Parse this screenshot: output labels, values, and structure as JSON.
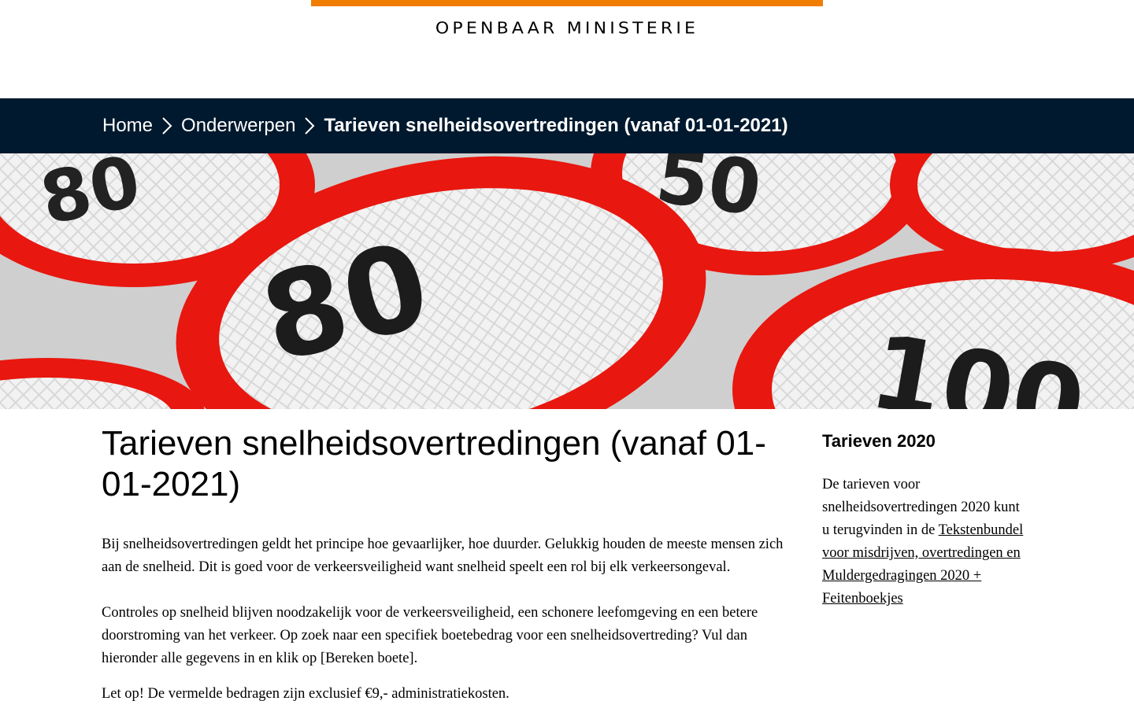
{
  "header": {
    "logo_text": "OPENBAAR MINISTERIE",
    "accent_color": "#f07d00"
  },
  "breadcrumb": {
    "background": "#01192e",
    "items": [
      {
        "label": "Home"
      },
      {
        "label": "Onderwerpen"
      }
    ],
    "current": "Tarieven snelheidsovertredingen (vanaf 01-01-2021)"
  },
  "hero": {
    "alt": "speed-limit-signs-photo",
    "signs": [
      "80",
      "50",
      "100"
    ]
  },
  "main": {
    "title": "Tarieven snelheidsovertredingen (vanaf 01-01-2021)",
    "paragraphs": [
      "Bij snelheidsovertredingen geldt het principe hoe gevaarlijker, hoe duurder. Gelukkig houden de meeste mensen zich aan de snelheid. Dit is goed voor de verkeersveiligheid want snelheid speelt een rol bij elk verkeersongeval.",
      "Controles op snelheid blijven noodzakelijk voor de verkeersveiligheid, een schonere leefomgeving en een betere doorstroming van het verkeer. Op zoek naar een specifiek boetebedrag voor een snelheidsovertreding? Vul dan hieronder alle gegevens in en klik op [Bereken boete].",
      "Let op! De vermelde bedragen zijn exclusief €9,- administratiekosten."
    ]
  },
  "sidebar": {
    "title": "Tarieven 2020",
    "text": "De tarieven voor snelheidsovertredingen 2020 kunt u terugvinden in de",
    "link_label": "Tekstenbundel voor misdrijven, overtredingen en Muldergedragingen 2020 + Feitenboekjes"
  }
}
